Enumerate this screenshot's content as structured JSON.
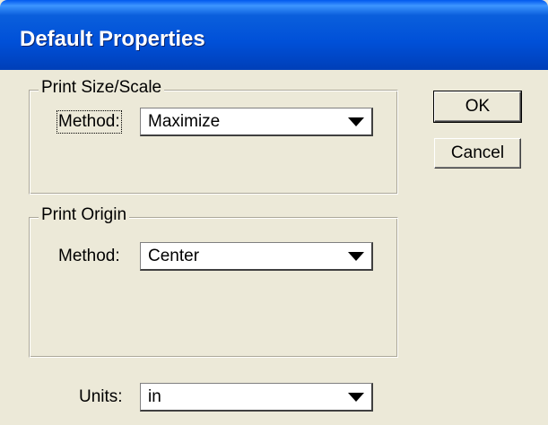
{
  "window": {
    "title": "Default Properties"
  },
  "buttons": {
    "ok_label": "OK",
    "cancel_label": "Cancel"
  },
  "print_size_group": {
    "label": "Print Size/Scale",
    "method_label": "Method:",
    "method_value": "Maximize"
  },
  "print_origin_group": {
    "label": "Print Origin",
    "method_label": "Method:",
    "method_value": "Center"
  },
  "units": {
    "label": "Units:",
    "value": "in"
  },
  "icons": {
    "dropdown_arrow": "triangle-down-icon"
  },
  "colors": {
    "title_bar": "#0050d8",
    "dialog_bg": "#ece9d8"
  }
}
